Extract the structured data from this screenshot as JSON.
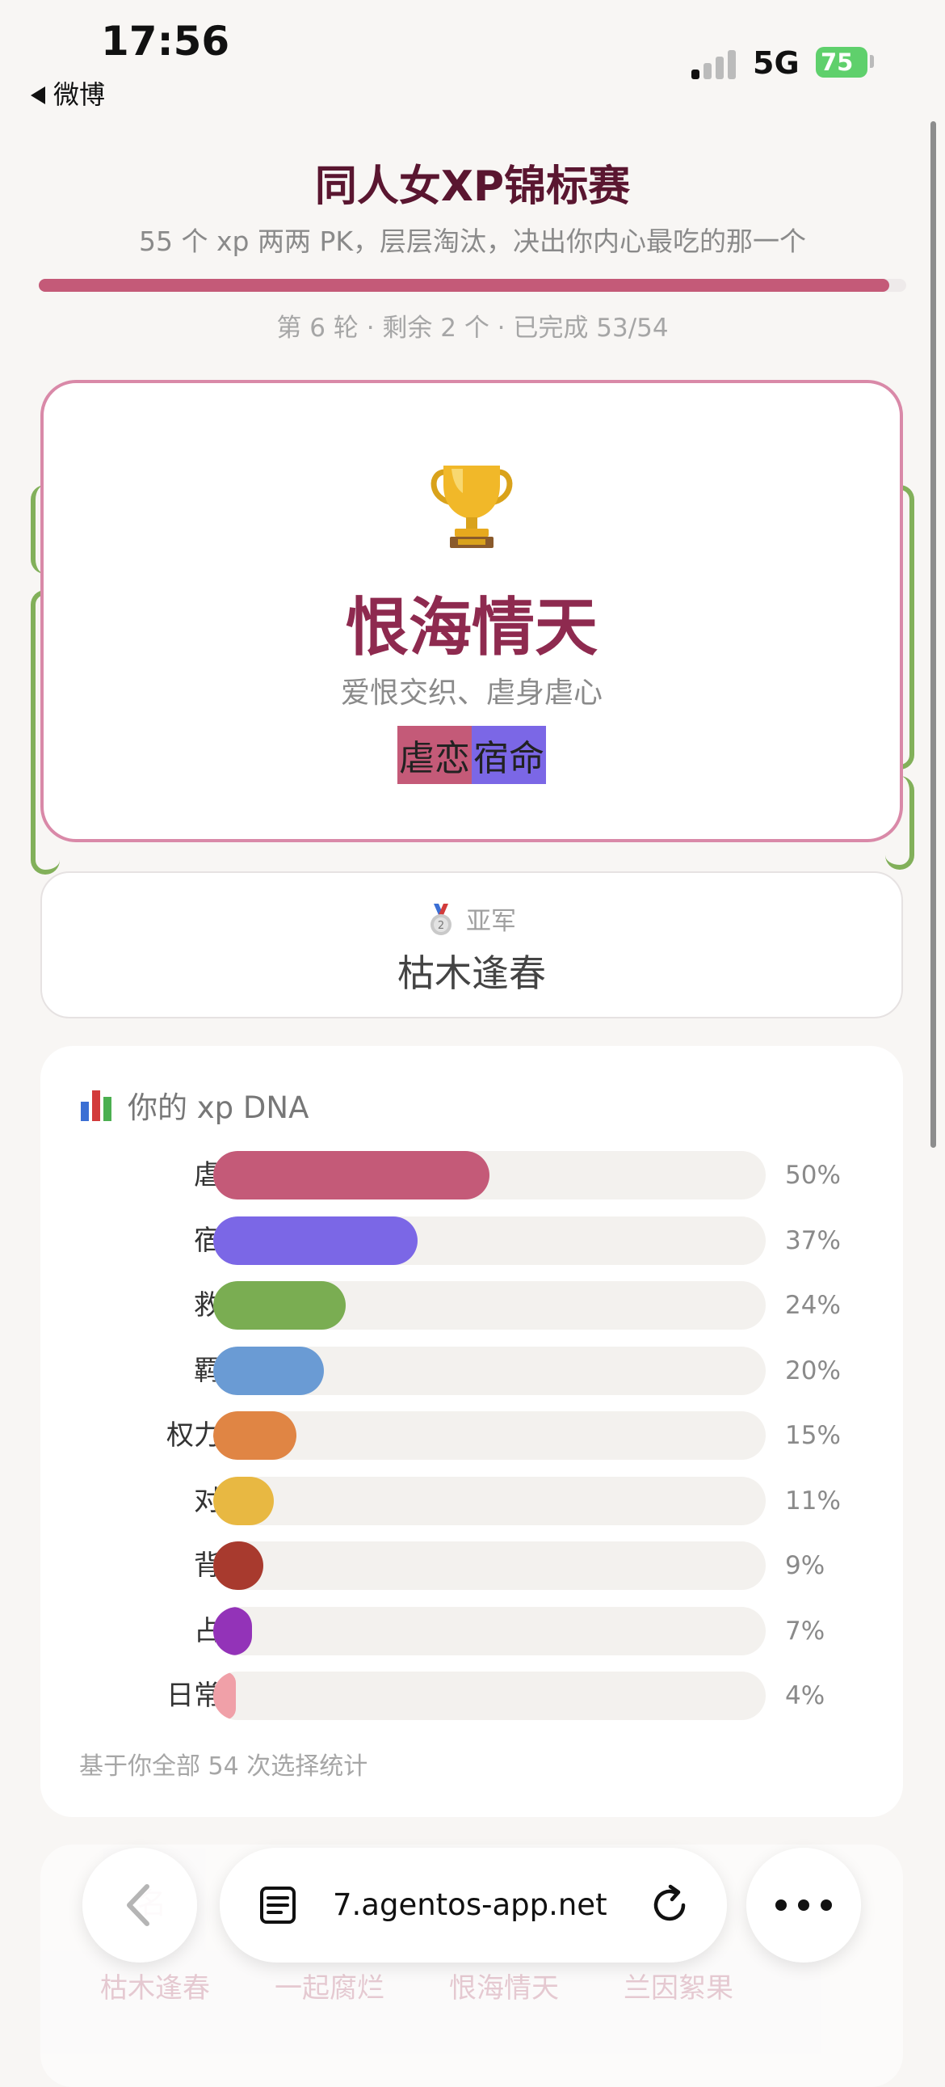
{
  "status_bar": {
    "time": "17:56",
    "back_app": "微博",
    "network": "5G",
    "battery": "75"
  },
  "header": {
    "title": "同人女XP锦标赛",
    "subtitle": "55 个 xp 两两 PK，层层淘汰，决出你内心最吃的那一个",
    "progress_fraction": 0.98,
    "round_info": "第 6 轮 · 剩余 2 个 · 已完成 53/54"
  },
  "champion": {
    "icon": "trophy-icon",
    "name": "恨海情天",
    "description": "爱恨交织、虐身虐心",
    "tags": [
      "虐恋",
      "宿命"
    ]
  },
  "runner_up": {
    "label": "亚军",
    "name": "枯木逢春",
    "icon": "silver-medal-icon"
  },
  "dna": {
    "title": "你的 xp DNA",
    "items": [
      {
        "label": "虐恋",
        "value": 50,
        "pct": "50%",
        "color": "#c45a78"
      },
      {
        "label": "宿命",
        "value": 37,
        "pct": "37%",
        "color": "#7b67e6"
      },
      {
        "label": "救赎",
        "value": 24,
        "pct": "24%",
        "color": "#7aad52"
      },
      {
        "label": "羁绊",
        "value": 20,
        "pct": "20%",
        "color": "#6a9bd4"
      },
      {
        "label": "权力差",
        "value": 15,
        "pct": "15%",
        "color": "#e08544"
      },
      {
        "label": "对抗",
        "value": 11,
        "pct": "11%",
        "color": "#e8b842"
      },
      {
        "label": "背德",
        "value": 9,
        "pct": "9%",
        "color": "#a83a2e"
      },
      {
        "label": "占有",
        "value": 7,
        "pct": "7%",
        "color": "#9333b8"
      },
      {
        "label": "日常甜",
        "value": 4,
        "pct": "4%",
        "color": "#f0a0a8"
      }
    ],
    "note": "基于你全部 54 次选择统计"
  },
  "ranking_card": {
    "title": "名",
    "chips": [
      "枯木逢春",
      "一起腐烂",
      "恨海情天",
      "兰因絮果"
    ]
  },
  "browser": {
    "url": "7.agentos-app.net"
  }
}
